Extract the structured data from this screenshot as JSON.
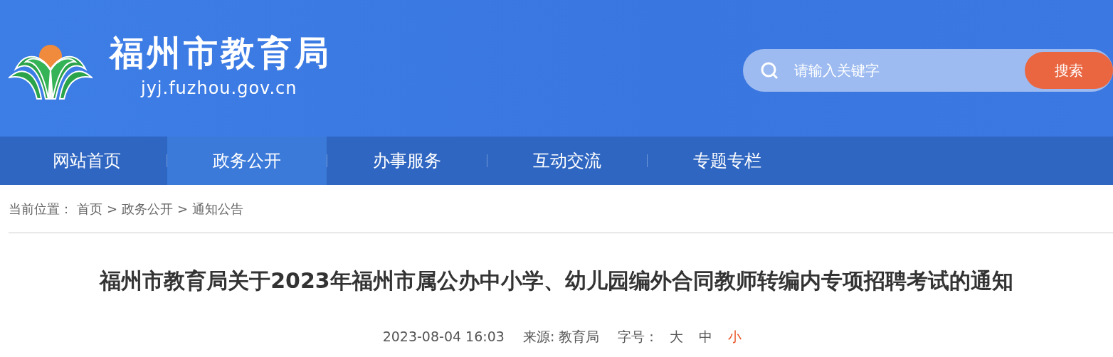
{
  "header": {
    "site_name": "福州市教育局",
    "domain": "jyj.fuzhou.gov.cn",
    "search": {
      "placeholder": "请输入关键字",
      "button": "搜索"
    }
  },
  "nav": [
    {
      "label": "网站首页",
      "selected": false
    },
    {
      "label": "政务公开",
      "selected": true
    },
    {
      "label": "办事服务",
      "selected": false
    },
    {
      "label": "互动交流",
      "selected": false
    },
    {
      "label": "专题专栏",
      "selected": false
    }
  ],
  "breadcrumb": {
    "label": "当前位置：",
    "separator": ">",
    "items": [
      "首页",
      "政务公开",
      "通知公告"
    ]
  },
  "article": {
    "title": "福州市教育局关于2023年福州市属公办中小学、幼儿园编外合同教师转编内专项招聘考试的通知",
    "date": "2023-08-04 16:03",
    "source": "来源: 教育局",
    "font_size_label": "字号：",
    "font_sizes": [
      {
        "label": "大",
        "selected": false
      },
      {
        "label": "中",
        "selected": false
      },
      {
        "label": "小",
        "selected": true
      }
    ]
  }
}
